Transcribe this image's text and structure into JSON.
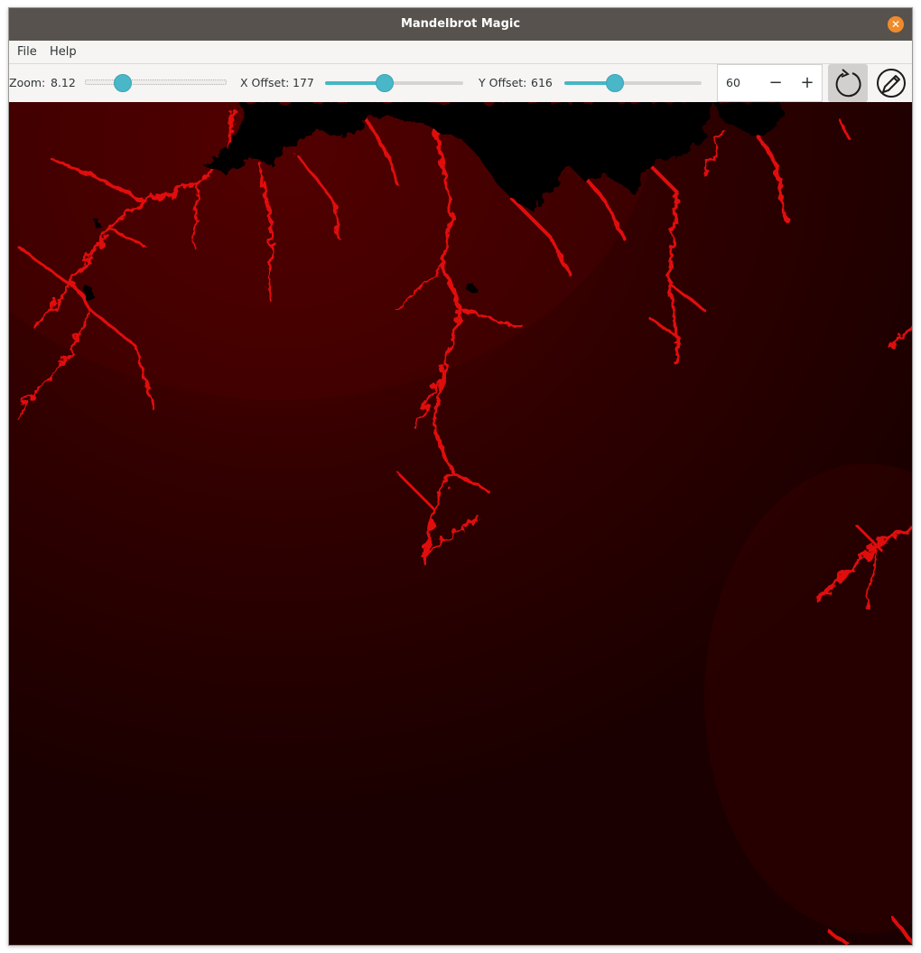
{
  "window": {
    "title": "Mandelbrot Magic",
    "close_icon": "close-icon"
  },
  "menu": {
    "items": [
      "File",
      "Help"
    ]
  },
  "toolbar": {
    "zoom": {
      "label": "Zoom:",
      "value": "8.12",
      "fraction": 0.27
    },
    "x_offset": {
      "label": "X Offset:",
      "value": "177",
      "fraction": 0.43
    },
    "y_offset": {
      "label": "Y Offset:",
      "value": "616",
      "fraction": 0.37
    },
    "iterations": {
      "value": "60",
      "decrement_icon": "minus-icon",
      "increment_icon": "plus-icon"
    },
    "refresh_icon": "refresh-icon",
    "edit_icon": "pencil-icon"
  },
  "colors": {
    "accent": "#4ab7c8",
    "titlebar": "#57524d",
    "close": "#f08b2b",
    "fractal_bright": "#ff1a1a",
    "fractal_dark": "#1a0000",
    "fractal_interior": "#000000"
  }
}
